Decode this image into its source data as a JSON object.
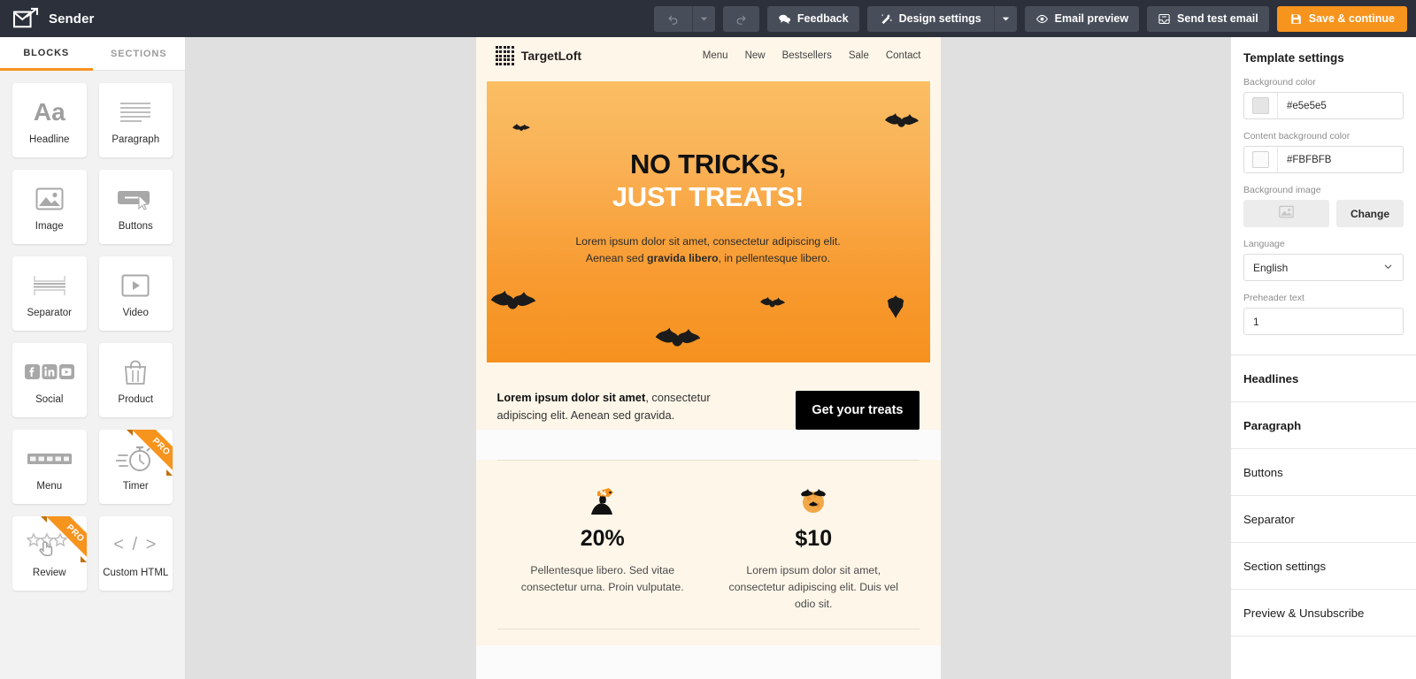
{
  "app": {
    "brand": "Sender",
    "logo_icon": "mail-arrow-icon"
  },
  "toolbar": {
    "undo": {
      "label": "Undo",
      "icon": "undo-icon",
      "disabled": true
    },
    "undo_dropdown": {
      "icon": "chevron-down-icon",
      "disabled": true
    },
    "redo": {
      "label": "Redo",
      "icon": "redo-icon",
      "disabled": true
    },
    "feedback": {
      "label": "Feedback",
      "icon": "chat-bubbles-icon"
    },
    "design_settings": {
      "label": "Design settings",
      "icon": "magic-wand-icon"
    },
    "design_settings_dropdown": {
      "icon": "chevron-down-icon"
    },
    "email_preview": {
      "label": "Email preview",
      "icon": "eye-icon"
    },
    "send_test_email": {
      "label": "Send test email",
      "icon": "inbox-icon"
    },
    "save_continue": {
      "label": "Save & continue",
      "icon": "save-disk-icon",
      "color": "#f7941d"
    }
  },
  "left_panel": {
    "tabs": [
      {
        "label": "BLOCKS",
        "active": true
      },
      {
        "label": "SECTIONS",
        "active": false
      }
    ],
    "blocks": [
      {
        "label": "Headline",
        "icon": "aa-text-icon",
        "pro": false
      },
      {
        "label": "Paragraph",
        "icon": "paragraph-lines-icon",
        "pro": false
      },
      {
        "label": "Image",
        "icon": "image-icon",
        "pro": false
      },
      {
        "label": "Buttons",
        "icon": "button-cursor-icon",
        "pro": false
      },
      {
        "label": "Separator",
        "icon": "separator-icon",
        "pro": false
      },
      {
        "label": "Video",
        "icon": "video-play-icon",
        "pro": false
      },
      {
        "label": "Social",
        "icon": "social-networks-icon",
        "pro": false
      },
      {
        "label": "Product",
        "icon": "shopping-bag-icon",
        "pro": false
      },
      {
        "label": "Menu",
        "icon": "menu-bar-icon",
        "pro": false
      },
      {
        "label": "Timer",
        "icon": "stopwatch-icon",
        "pro": true
      },
      {
        "label": "Review",
        "icon": "stars-rating-icon",
        "pro": true
      },
      {
        "label": "Custom HTML",
        "icon": "code-brackets-icon",
        "pro": false
      }
    ],
    "pro_badge": "PRO"
  },
  "email": {
    "header": {
      "logo_icon": "dot-grid-logo-icon",
      "brand": "TargetLoft",
      "nav": [
        "Menu",
        "New",
        "Bestsellers",
        "Sale",
        "Contact"
      ]
    },
    "hero": {
      "title_line1": "NO TRICKS,",
      "title_line2": "JUST TREATS!",
      "body_line1": "Lorem ipsum dolor sit amet, consectetur adipiscing elit.",
      "body_line2_pre": "Aenean sed ",
      "body_line2_bold": "gravida libero",
      "body_line2_post": ", in pellentesque libero.",
      "gradient_from": "#FBBE63",
      "gradient_to": "#F6911E",
      "decoration_icon": "bat-icon"
    },
    "intro": {
      "bold": "Lorem ipsum dolor sit amet",
      "rest": ", consectetur adipiscing elit. Aenean sed gravida.",
      "cta_label": "Get your treats"
    },
    "features": [
      {
        "icon": "cauldron-discount-icon",
        "value": "20%",
        "desc": "Pellentesque libero. Sed vitae consectetur urna. Proin vulputate."
      },
      {
        "icon": "moon-bats-icon",
        "value": "$10",
        "desc": "Lorem ipsum dolor sit amet, consectetur adipiscing elit. Duis vel odio sit."
      }
    ]
  },
  "right_panel": {
    "title": "Template settings",
    "background_color": {
      "label": "Background color",
      "value": "#e5e5e5",
      "swatch": "#e5e5e5"
    },
    "content_background_color": {
      "label": "Content background color",
      "value": "#FBFBFB",
      "swatch": "#FBFBFB"
    },
    "background_image": {
      "label": "Background image",
      "change_label": "Change",
      "placeholder_icon": "image-placeholder-icon"
    },
    "language": {
      "label": "Language",
      "value": "English",
      "chevron_icon": "chevron-down-icon"
    },
    "preheader": {
      "label": "Preheader text",
      "value": "1"
    },
    "sections": [
      "Headlines",
      "Paragraph",
      "Buttons",
      "Separator",
      "Section settings",
      "Preview & Unsubscribe"
    ]
  }
}
